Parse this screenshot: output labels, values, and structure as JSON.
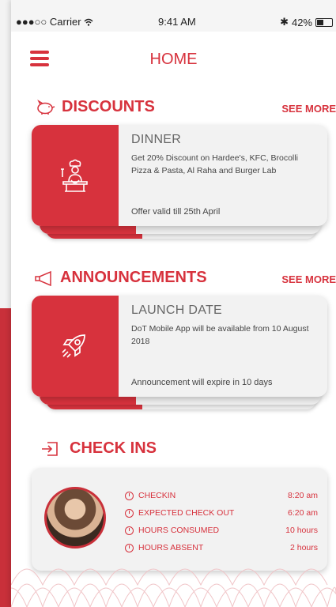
{
  "status_bar": {
    "carrier": "●●●○○ Carrier",
    "wifi": "wifi-icon",
    "time": "9:41 AM",
    "bluetooth": "✱",
    "battery": "42%"
  },
  "header": {
    "title": "HOME"
  },
  "discounts": {
    "heading": "DISCOUNTS",
    "see_more": "SEE MORE",
    "card": {
      "title": "DINNER",
      "description": "Get 20% Discount on Hardee's, KFC, Brocolli Pizza & Pasta, Al Raha and Burger Lab",
      "footer": "Offer valid till 25th April"
    }
  },
  "announcements": {
    "heading": "ANNOUNCEMENTS",
    "see_more": "SEE MORE",
    "card": {
      "title": "LAUNCH DATE",
      "description": "DoT Mobile App will be available from 10 August 2018",
      "footer": "Announcement will expire in 10 days"
    }
  },
  "checkins": {
    "heading": "CHECK INS",
    "rows": [
      {
        "label": "CHECKIN",
        "value": "8:20 am"
      },
      {
        "label": "EXPECTED CHECK OUT",
        "value": "6:20 am"
      },
      {
        "label": "HOURS CONSUMED",
        "value": "10 hours"
      },
      {
        "label": "HOURS ABSENT",
        "value": "2 hours"
      }
    ]
  },
  "colors": {
    "accent": "#d7323d",
    "card_bg": "#f2f2f2"
  }
}
